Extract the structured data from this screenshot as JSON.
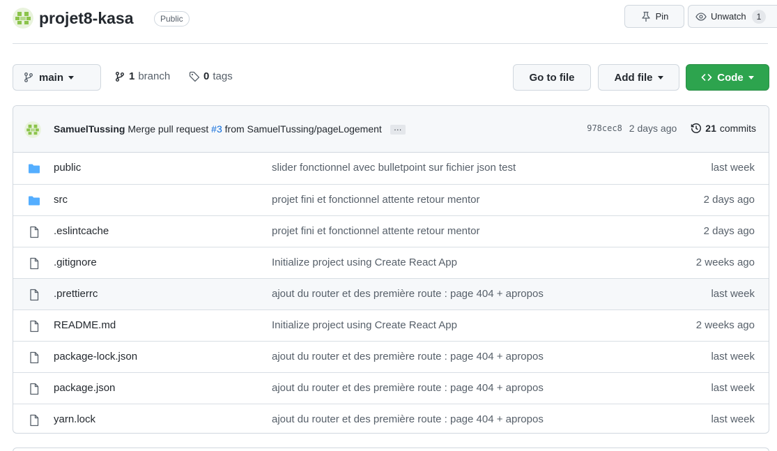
{
  "repo": {
    "name": "projet8-kasa",
    "visibility": "Public",
    "pin_label": "Pin",
    "watch_label": "Unwatch",
    "watch_count": "1",
    "avatar_icon": "identicon-avatar"
  },
  "toolbar": {
    "branch_name": "main",
    "branches_count": "1",
    "branches_label": "branch",
    "tags_count": "0",
    "tags_label": "tags",
    "go_to_file": "Go to file",
    "add_file": "Add file",
    "code": "Code"
  },
  "latest_commit": {
    "author": "SamuelTussing",
    "message_prefix": "Merge pull request",
    "pr_number": "#3",
    "message_suffix": "from SamuelTussing/pageLogement",
    "ellipsis": "…",
    "sha": "978cec8",
    "age": "2 days ago",
    "commits_count": "21",
    "commits_label": "commits"
  },
  "files": [
    {
      "type": "folder",
      "name": "public",
      "message": "slider fonctionnel avec bulletpoint sur fichier json test",
      "age": "last week"
    },
    {
      "type": "folder",
      "name": "src",
      "message": "projet fini et fonctionnel attente retour mentor",
      "age": "2 days ago"
    },
    {
      "type": "file",
      "name": ".eslintcache",
      "message": "projet fini et fonctionnel attente retour mentor",
      "age": "2 days ago"
    },
    {
      "type": "file",
      "name": ".gitignore",
      "message": "Initialize project using Create React App",
      "age": "2 weeks ago"
    },
    {
      "type": "file",
      "name": ".prettierrc",
      "message": "ajout du router et des première route : page 404 + apropos",
      "age": "last week"
    },
    {
      "type": "file",
      "name": "README.md",
      "message": "Initialize project using Create React App",
      "age": "2 weeks ago"
    },
    {
      "type": "file",
      "name": "package-lock.json",
      "message": "ajout du router et des première route : page 404 + apropos",
      "age": "last week"
    },
    {
      "type": "file",
      "name": "package.json",
      "message": "ajout du router et des première route : page 404 + apropos",
      "age": "last week"
    },
    {
      "type": "file",
      "name": "yarn.lock",
      "message": "ajout du router et des première route : page 404 + apropos",
      "age": "last week"
    }
  ],
  "colors": {
    "accent_green": "#2da44e",
    "link_blue": "#0969da",
    "folder_blue": "#54aeff",
    "avatar_green": "#8bc34a"
  }
}
